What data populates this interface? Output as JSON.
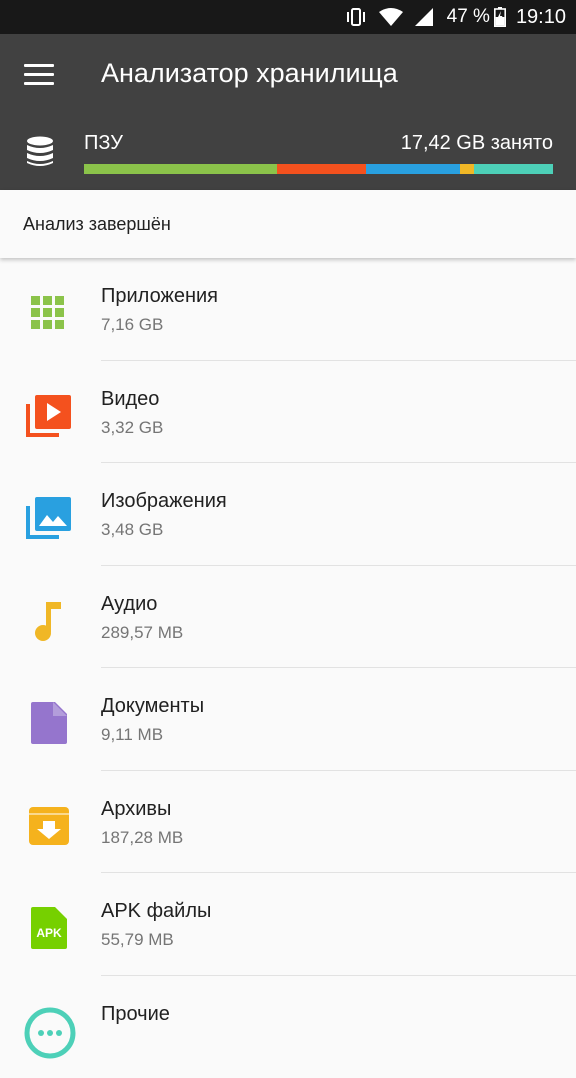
{
  "status_bar": {
    "battery_percent": "47 %",
    "time": "19:10"
  },
  "app_bar": {
    "title": "Анализатор хранилища"
  },
  "storage": {
    "label": "ПЗУ",
    "used": "17,42 GB занято",
    "segments": [
      {
        "category": "Приложения",
        "color": "#8bc34a",
        "fraction": 0.411
      },
      {
        "category": "Видео",
        "color": "#f4511e",
        "fraction": 0.191
      },
      {
        "category": "Изображения",
        "color": "#29a0e0",
        "fraction": 0.2
      },
      {
        "category": "Аудио",
        "color": "#f0b726",
        "fraction": 0.029
      },
      {
        "category": "Прочие",
        "color": "#4dd0b8",
        "fraction": 0.169
      }
    ]
  },
  "analysis_status": "Анализ завершён",
  "categories": [
    {
      "name": "Приложения",
      "size": "7,16 GB",
      "icon": "apps-grid-icon",
      "color": "#8bc34a"
    },
    {
      "name": "Видео",
      "size": "3,32 GB",
      "icon": "video-library-icon",
      "color": "#f4511e"
    },
    {
      "name": "Изображения",
      "size": "3,48 GB",
      "icon": "photo-library-icon",
      "color": "#29a0e0"
    },
    {
      "name": "Аудио",
      "size": "289,57 MB",
      "icon": "music-note-icon",
      "color": "#f0b726"
    },
    {
      "name": "Документы",
      "size": "9,11 MB",
      "icon": "document-icon",
      "color": "#9575cd"
    },
    {
      "name": "Архивы",
      "size": "187,28 MB",
      "icon": "archive-icon",
      "color": "#f5b21d"
    },
    {
      "name": "APK файлы",
      "size": "55,79 MB",
      "icon": "apk-icon",
      "color": "#76d000",
      "icon_text": "APK"
    },
    {
      "name": "Прочие",
      "size": "",
      "icon": "other-files-icon",
      "color": "#4dd0b8"
    }
  ]
}
